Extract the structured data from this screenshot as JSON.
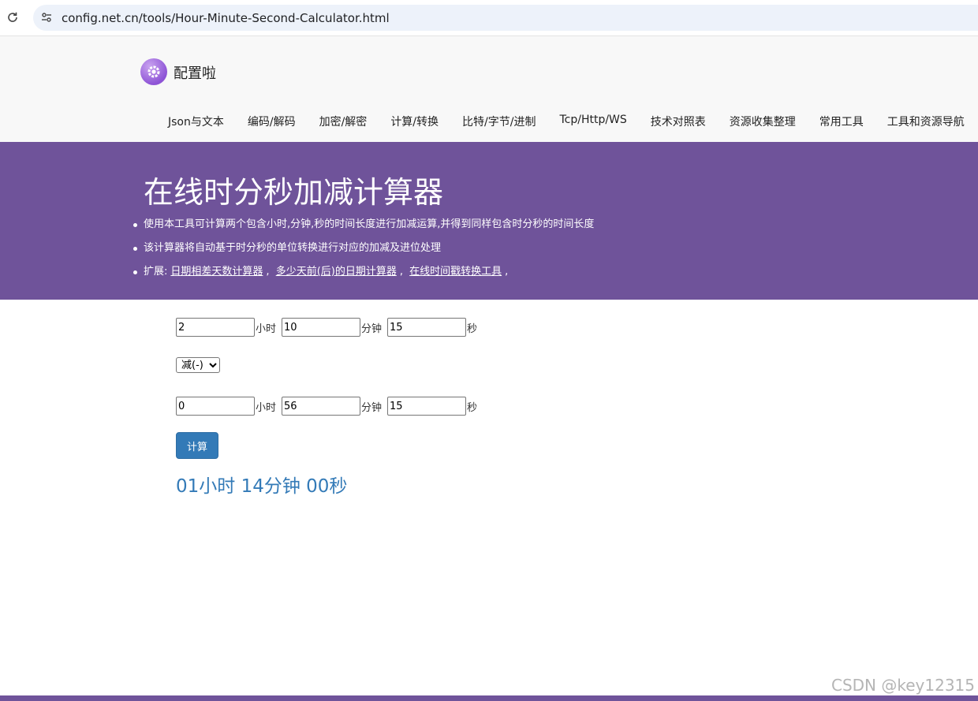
{
  "browser": {
    "url": "config.net.cn/tools/Hour-Minute-Second-Calculator.html"
  },
  "site": {
    "name": "配置啦",
    "nav": [
      "Json与文本",
      "编码/解码",
      "加密/解密",
      "计算/转换",
      "比特/字节/进制",
      "Tcp/Http/WS",
      "技术对照表",
      "资源收集整理",
      "常用工具",
      "工具和资源导航"
    ]
  },
  "banner": {
    "title": "在线时分秒加减计算器",
    "bullet1": "使用本工具可计算两个包含小时,分钟,秒的时间长度进行加减运算,并得到同样包含时分秒的时间长度",
    "bullet2": "该计算器将自动基于时分秒的单位转换进行对应的加减及进位处理",
    "bullet3_prefix": "扩展:",
    "links": [
      "日期相差天数计算器",
      "多少天前(后)的日期计算器",
      "在线时间戳转换工具"
    ],
    "separator": ",",
    "end_separator": ","
  },
  "form": {
    "first": {
      "hours": "2",
      "minutes": "10",
      "seconds": "15"
    },
    "operation": "减(-)",
    "second": {
      "hours": "0",
      "minutes": "56",
      "seconds": "15"
    },
    "unit_hour": "小时",
    "unit_minute": "分钟",
    "unit_second": "秒",
    "calc_label": "计算"
  },
  "result": "01小时 14分钟 00秒",
  "watermark": "CSDN @key12315",
  "colors": {
    "banner": "#6f539a",
    "button": "#337ab7",
    "result": "#337ab7"
  }
}
